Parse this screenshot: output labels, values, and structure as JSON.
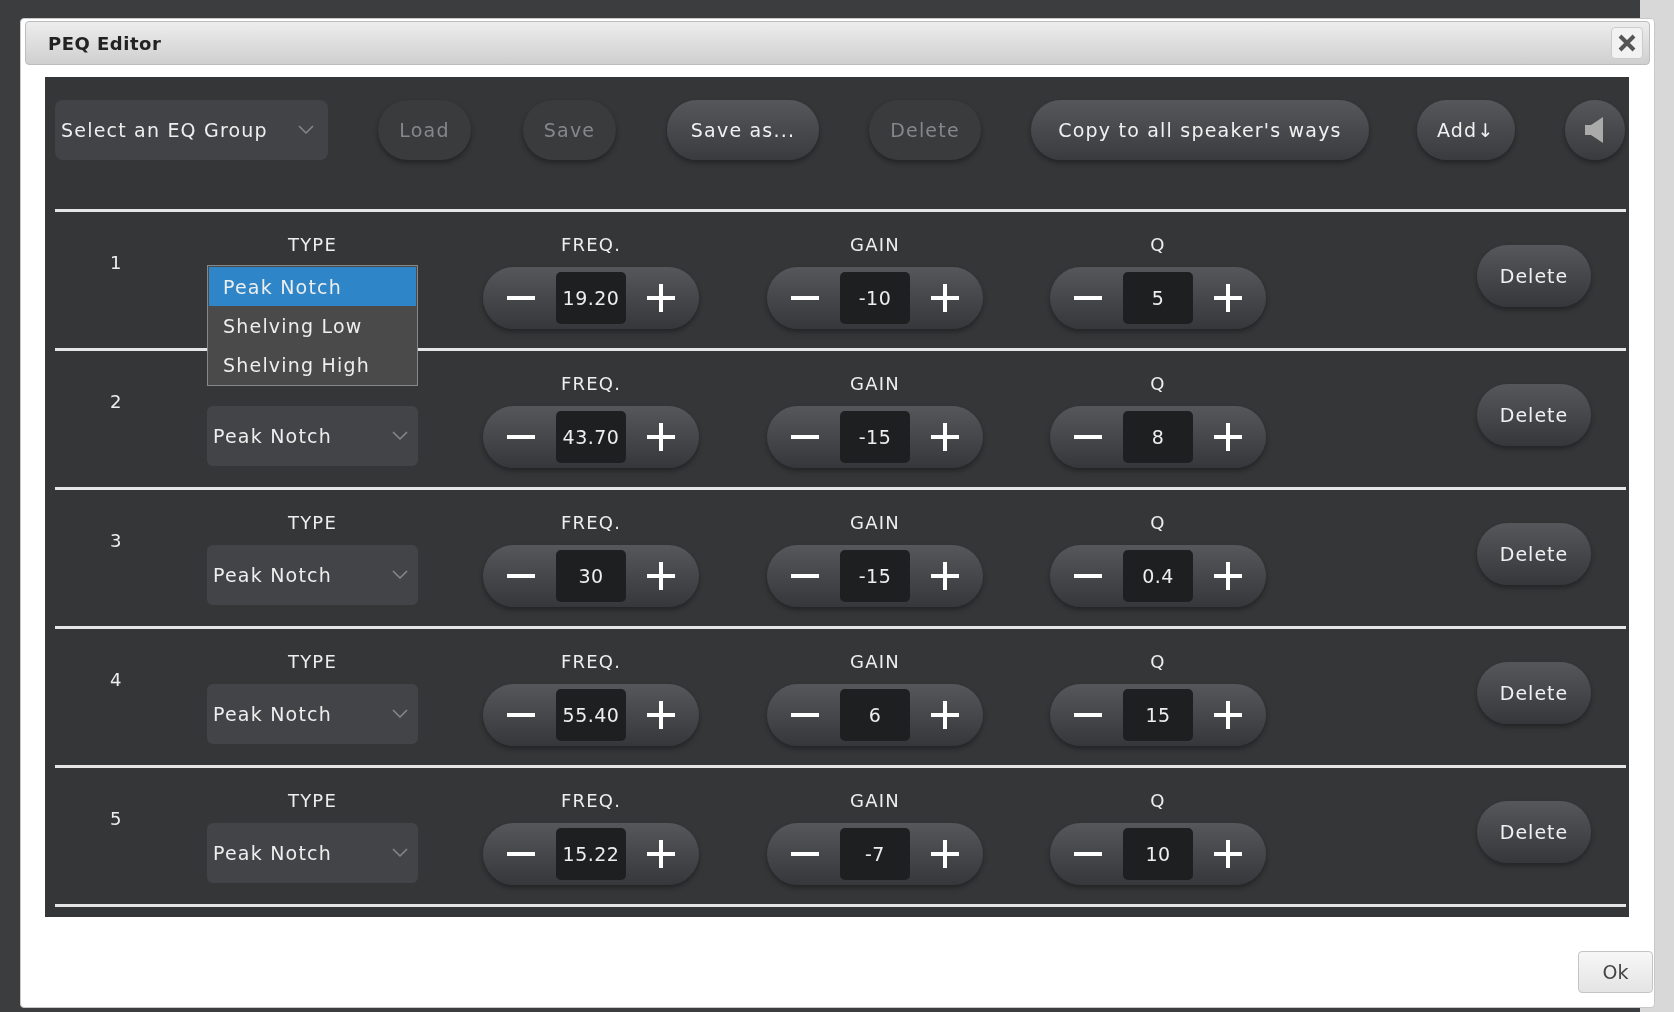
{
  "dialog": {
    "title": "PEQ Editor"
  },
  "toolbar": {
    "group_select": {
      "value": "Select an EQ Group"
    },
    "buttons": [
      {
        "kind": "text",
        "label": "Load",
        "disabled": true
      },
      {
        "kind": "text",
        "label": "Save",
        "disabled": true
      },
      {
        "kind": "text",
        "label": "Save as...",
        "disabled": false
      },
      {
        "kind": "text",
        "label": "Delete",
        "disabled": true
      },
      {
        "kind": "text",
        "label": "Copy to all speaker's ways",
        "disabled": false
      },
      {
        "kind": "text",
        "label": "Add↓",
        "disabled": false
      },
      {
        "kind": "speaker",
        "disabled": false
      }
    ]
  },
  "filters": [
    {
      "number": "1",
      "type_label": "TYPE",
      "type_menu": [
        {
          "label": "Peak Notch",
          "selected": true
        },
        {
          "label": "Shelving Low",
          "selected": false
        },
        {
          "label": "Shelving High",
          "selected": false
        }
      ],
      "freq_label": "FREQ.",
      "freq": "19.20",
      "gain_label": "GAIN",
      "gain": "-10",
      "q_label": "Q",
      "q": "5",
      "delete": "Delete"
    },
    {
      "number": "2",
      "type": "Peak Notch",
      "freq_label": "FREQ.",
      "freq": "43.70",
      "gain_label": "GAIN",
      "gain": "-15",
      "q_label": "Q",
      "q": "8",
      "delete": "Delete"
    },
    {
      "number": "3",
      "type_label": "TYPE",
      "type": "Peak Notch",
      "freq_label": "FREQ.",
      "freq": "30",
      "gain_label": "GAIN",
      "gain": "-15",
      "q_label": "Q",
      "q": "0.4",
      "delete": "Delete"
    },
    {
      "number": "4",
      "type_label": "TYPE",
      "type": "Peak Notch",
      "freq_label": "FREQ.",
      "freq": "55.40",
      "gain_label": "GAIN",
      "gain": "6",
      "q_label": "Q",
      "q": "15",
      "delete": "Delete"
    },
    {
      "number": "5",
      "type_label": "TYPE",
      "type": "Peak Notch",
      "freq_label": "FREQ.",
      "freq": "15.22",
      "gain_label": "GAIN",
      "gain": "-7",
      "q_label": "Q",
      "q": "10",
      "delete": "Delete"
    }
  ],
  "footer": {
    "ok": "Ok"
  }
}
